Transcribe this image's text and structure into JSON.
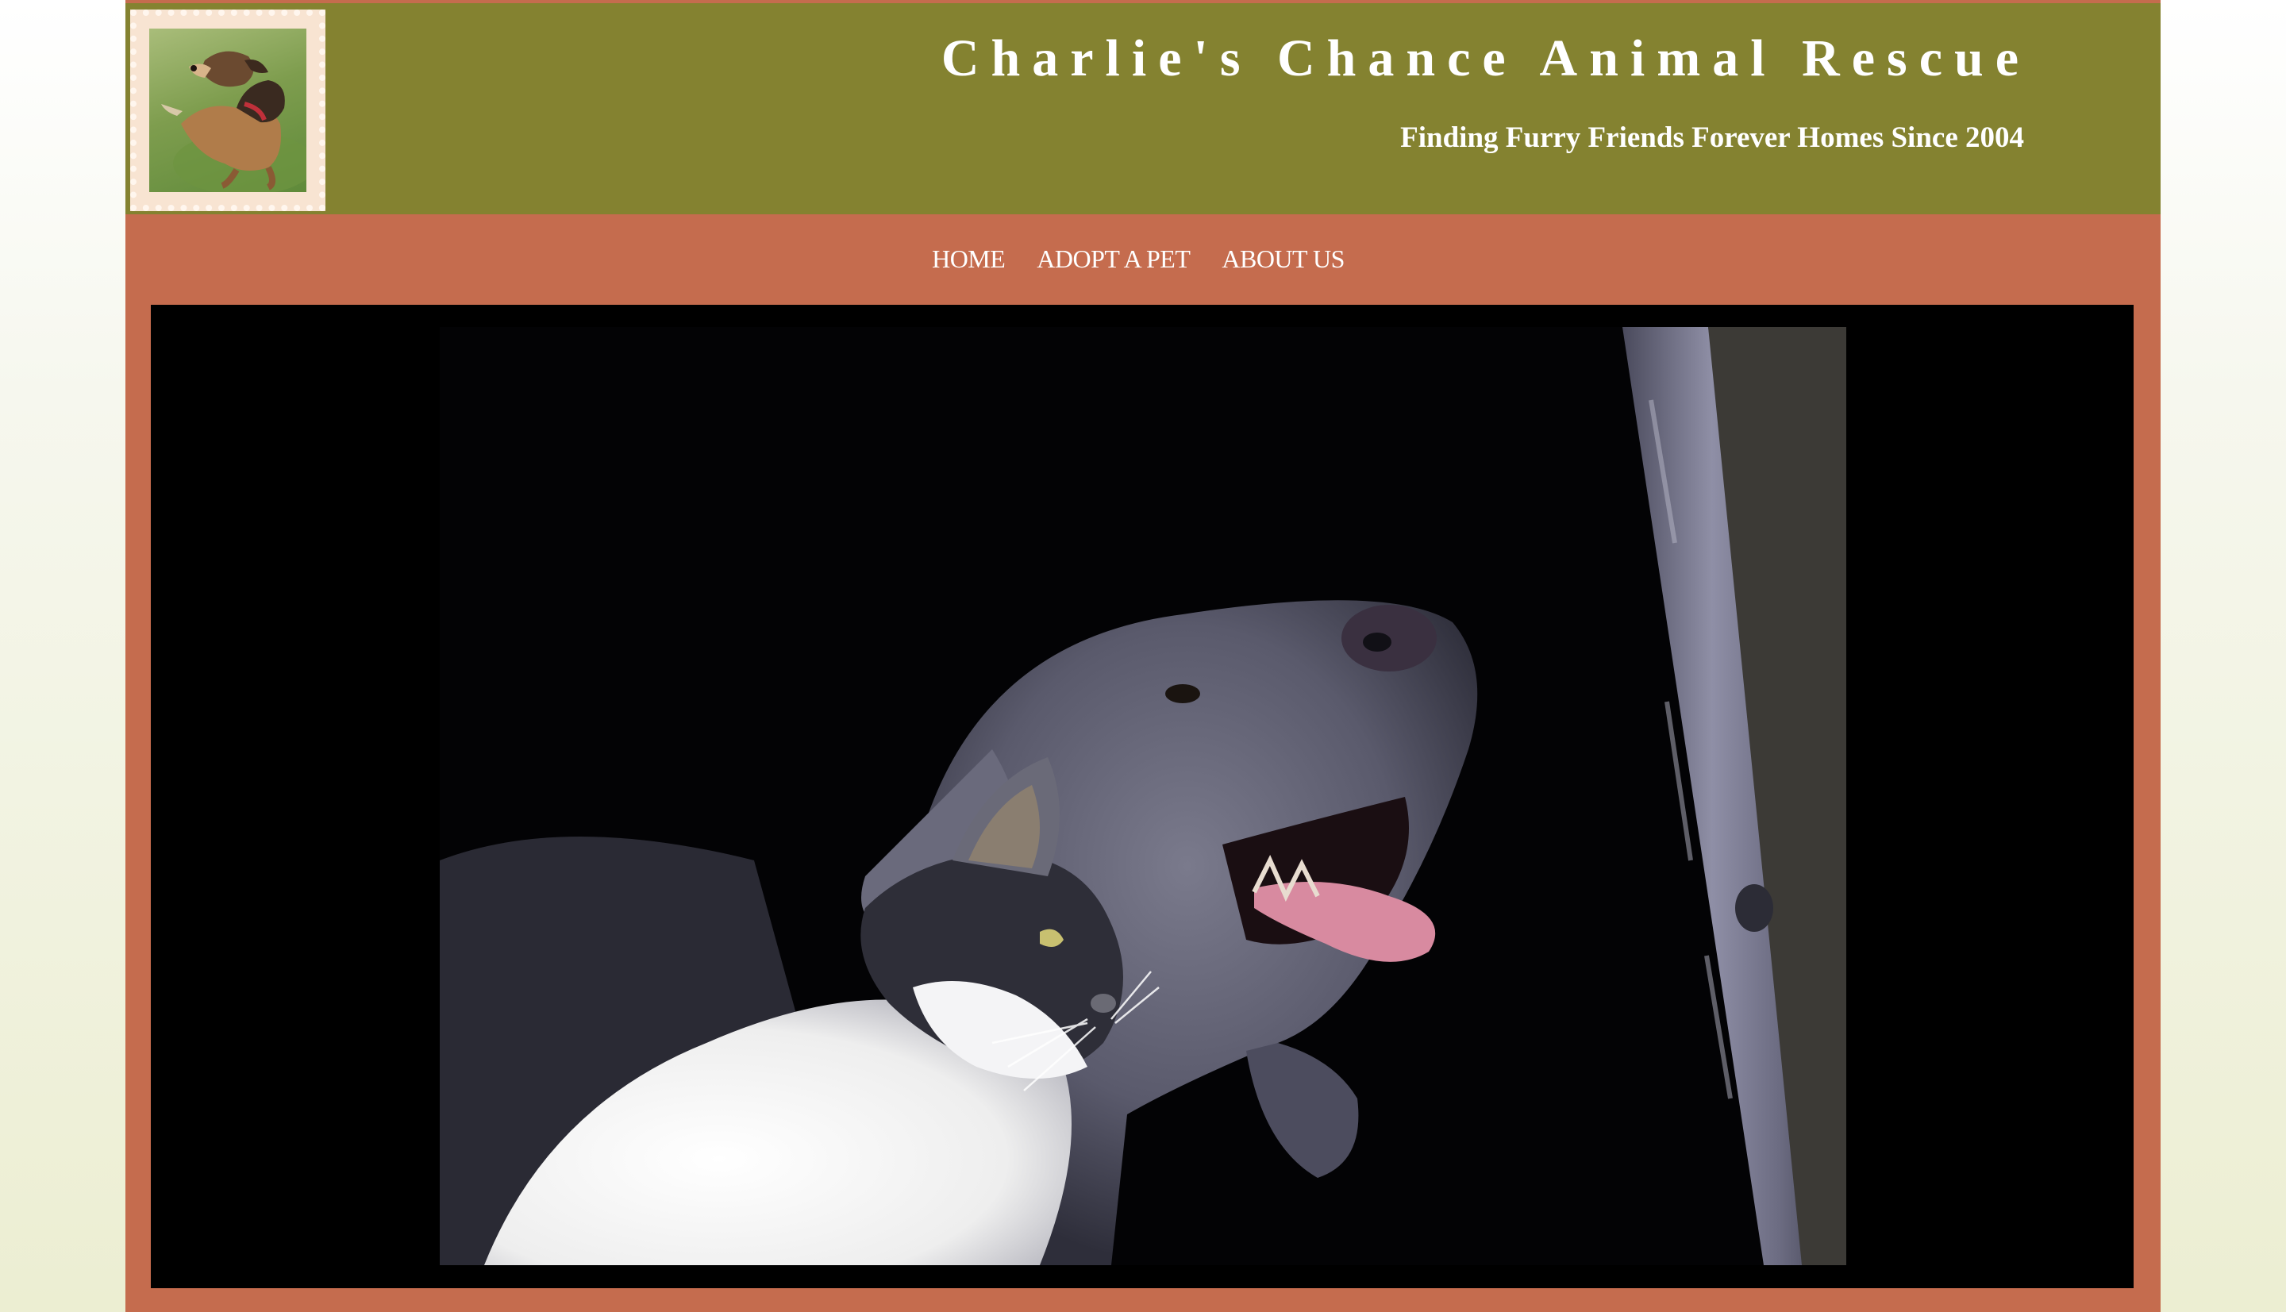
{
  "site": {
    "title": "Charlie's Chance Animal Rescue",
    "tagline": "Finding Furry Friends Forever Homes Since 2004"
  },
  "logo": {
    "icon": "dog-painting-icon"
  },
  "nav": {
    "items": [
      {
        "label": "HOME"
      },
      {
        "label": "ADOPT A PET"
      },
      {
        "label": "ABOUT US"
      }
    ]
  },
  "hero": {
    "icon": "dog-and-cat-photo"
  },
  "colors": {
    "page_background": "#f3f5e4",
    "header_olive": "#848230",
    "terracotta": "#c56c4e",
    "hero_black": "#000000",
    "text_white": "#ffffff"
  }
}
